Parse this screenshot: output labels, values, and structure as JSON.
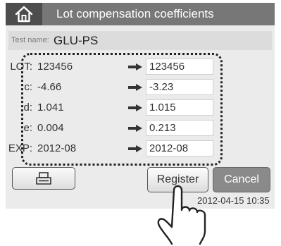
{
  "title": "Lot compensation coefficients",
  "test": {
    "label": "Test name:",
    "value": "GLU-PS"
  },
  "rows": [
    {
      "label": "LOT:",
      "old": "123456",
      "new": "123456"
    },
    {
      "label": "c:",
      "old": "-4.66",
      "new": "-3.23"
    },
    {
      "label": "d:",
      "old": "1.041",
      "new": "1.015"
    },
    {
      "label": "e:",
      "old": "0.004",
      "new": "0.213"
    },
    {
      "label": "EXP:",
      "old": "2012-08",
      "new": "2012-08"
    }
  ],
  "buttons": {
    "register": "Register",
    "cancel": "Cancel"
  },
  "datetime": "2012-04-15 10:35",
  "icons": {
    "home": "home-icon",
    "print": "printer-icon",
    "arrow": "right-arrow-icon"
  },
  "colors": {
    "titlebar": "#777777",
    "home_button": "#4d4d4d",
    "cancel_button": "#8a8a8a"
  }
}
